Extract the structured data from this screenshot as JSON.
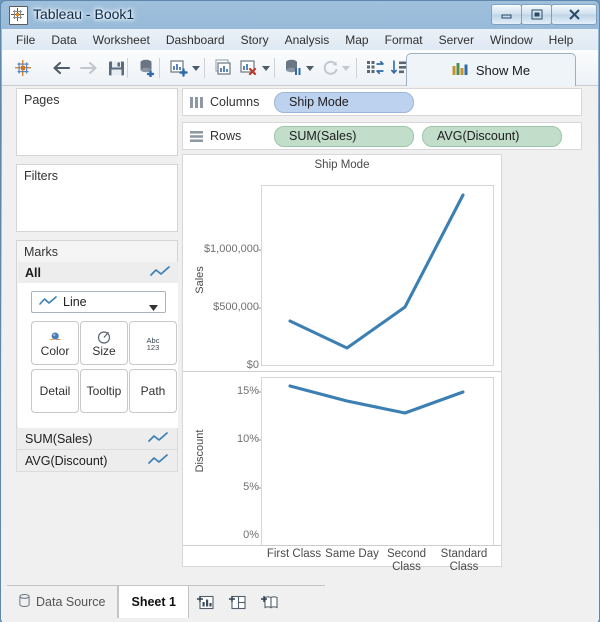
{
  "window": {
    "title": "Tableau - Book1",
    "app_icon": "tableau-logo-icon",
    "controls": {
      "minimize": "minimize-icon",
      "maximize": "maximize-icon",
      "close": "close-icon"
    }
  },
  "menubar": {
    "items": [
      {
        "label": "File"
      },
      {
        "label": "Data"
      },
      {
        "label": "Worksheet"
      },
      {
        "label": "Dashboard"
      },
      {
        "label": "Story"
      },
      {
        "label": "Analysis"
      },
      {
        "label": "Map"
      },
      {
        "label": "Format"
      },
      {
        "label": "Server"
      },
      {
        "label": "Window"
      },
      {
        "label": "Help"
      }
    ]
  },
  "toolbar": {
    "show_me_label": "Show Me",
    "buttons": [
      {
        "name": "tableau-home-icon"
      },
      {
        "name": "undo-arrow-icon"
      },
      {
        "name": "redo-arrow-icon"
      },
      {
        "name": "save-icon"
      },
      {
        "name": "new-data-source-icon"
      },
      {
        "name": "new-worksheet-icon"
      },
      {
        "name": "duplicate-sheet-icon"
      },
      {
        "name": "clear-sheet-icon"
      },
      {
        "name": "pause-auto-update-icon"
      },
      {
        "name": "refresh-icon"
      },
      {
        "name": "swap-rows-columns-icon"
      },
      {
        "name": "sort-descending-icon"
      }
    ]
  },
  "sidebar": {
    "pages": {
      "title": "Pages"
    },
    "filters": {
      "title": "Filters"
    },
    "marks": {
      "title": "Marks",
      "all_label": "All",
      "mark_type": "Line",
      "buttons": [
        {
          "label": "Color",
          "icon": "color-palette-icon"
        },
        {
          "label": "Size",
          "icon": "size-circle-icon"
        },
        {
          "label": "Label",
          "icon": "abc-123-icon"
        },
        {
          "label": "Detail",
          "icon": ""
        },
        {
          "label": "Tooltip",
          "icon": ""
        },
        {
          "label": "Path",
          "icon": ""
        }
      ]
    },
    "measure_shelves": [
      {
        "label": "SUM(Sales)",
        "icon": "line-mark-icon"
      },
      {
        "label": "AVG(Discount)",
        "icon": "line-mark-icon"
      }
    ]
  },
  "shelves": {
    "columns": {
      "label": "Columns",
      "icon": "columns-icon",
      "pills": [
        {
          "label": "Ship Mode",
          "type": "dimension"
        }
      ]
    },
    "rows": {
      "label": "Rows",
      "icon": "rows-icon",
      "pills": [
        {
          "label": "SUM(Sales)",
          "type": "measure"
        },
        {
          "label": "AVG(Discount)",
          "type": "measure"
        }
      ]
    }
  },
  "view": {
    "title": "Ship Mode"
  },
  "statusbar": {
    "data_source_tab": "Data Source",
    "sheet_tab": "Sheet 1",
    "new_worksheet_icon": "new-worksheet-icon",
    "new_dashboard_icon": "new-dashboard-icon",
    "new_story_icon": "new-story-icon"
  },
  "colors": {
    "line": "#3b7fb3",
    "pill_dimension": "#bdd2ef",
    "pill_measure": "#c2ddc9",
    "axis_text": "#707070"
  },
  "chart_data": [
    {
      "type": "line",
      "title": "Ship Mode",
      "xlabel": "Ship Mode",
      "ylabel": "Sales",
      "categories": [
        "First Class",
        "Same Day",
        "Second Class",
        "Standard Class"
      ],
      "values": [
        352000,
        132000,
        460000,
        1340000
      ],
      "ytick_labels": [
        "$0",
        "$500,000",
        "$1,000,000"
      ],
      "ytick_values": [
        0,
        500000,
        1000000
      ],
      "ylim": [
        0,
        1420000
      ],
      "grid": false,
      "legend": "none",
      "series_color": "#3b7fb3"
    },
    {
      "type": "line",
      "title": "Ship Mode",
      "xlabel": "Ship Mode",
      "ylabel": "Discount",
      "categories": [
        "First Class",
        "Same Day",
        "Second Class",
        "Standard Class"
      ],
      "values": [
        0.168,
        0.153,
        0.14,
        0.162
      ],
      "ytick_labels": [
        "0%",
        "5%",
        "10%",
        "15%"
      ],
      "ytick_values": [
        0,
        0.05,
        0.1,
        0.15
      ],
      "ylim": [
        0,
        0.178
      ],
      "grid": false,
      "legend": "none",
      "series_color": "#3b7fb3"
    }
  ]
}
